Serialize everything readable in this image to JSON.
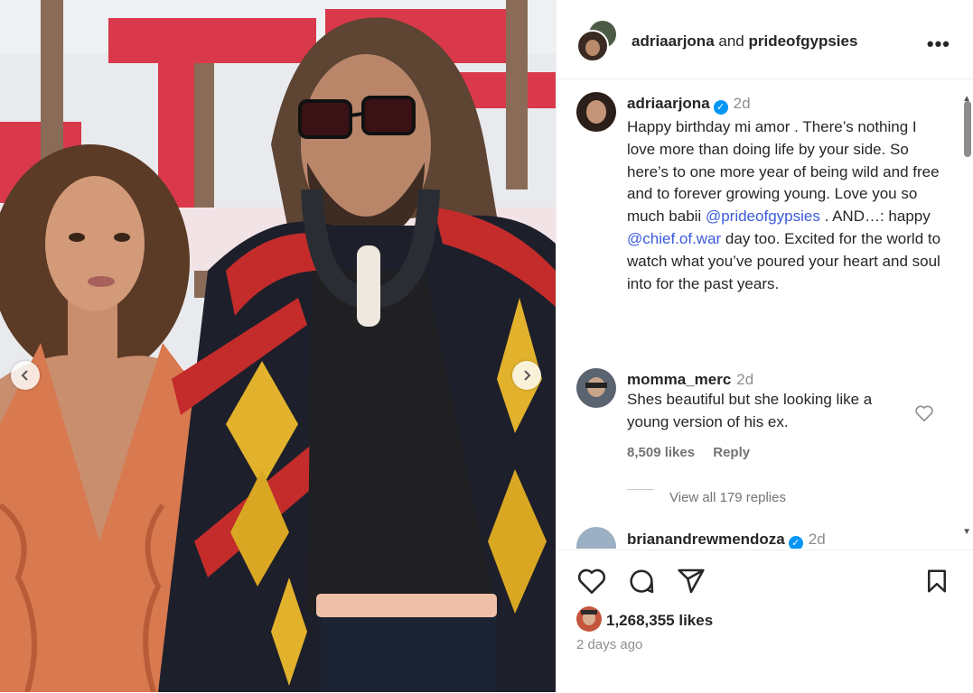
{
  "post": {
    "header": {
      "author": "adriaarjona",
      "connector": "and",
      "collaborator": "prideofgypsies",
      "more_icon": "more-horizontal-icon"
    },
    "caption": {
      "username": "adriaarjona",
      "verified": true,
      "time": "2d",
      "text_part1": "Happy birthday mi amor . There’s nothing I love more than doing life by your side. So here’s to one more year of being wild and free and to forever growing young. Love you so much babii",
      "mention1": "@prideofgypsies",
      "text_part2": ". AND…: happy",
      "mention2": "@chief.of.war",
      "text_part3": "day too. Excited for the world to watch what you’ve poured your heart and soul into for the past years."
    },
    "comments": [
      {
        "username": "momma_merc",
        "time": "2d",
        "text": "Shes beautiful but she looking like a young version of his ex.",
        "likes": "8,509 likes",
        "reply_label": "Reply",
        "view_replies": "View all 179 replies"
      },
      {
        "username": "brianandrewmendoza",
        "verified": true,
        "time": "2d"
      }
    ],
    "likes": "1,268,355 likes",
    "posted": "2 days ago"
  },
  "colors": {
    "link": "#3b5bdb",
    "verified": "#0095f6",
    "muted": "#8e8e8e",
    "backdrop_red": "#d9394a"
  },
  "icons": [
    "heart-icon",
    "comment-icon",
    "share-icon",
    "bookmark-icon",
    "chevron-left-icon",
    "chevron-right-icon"
  ]
}
